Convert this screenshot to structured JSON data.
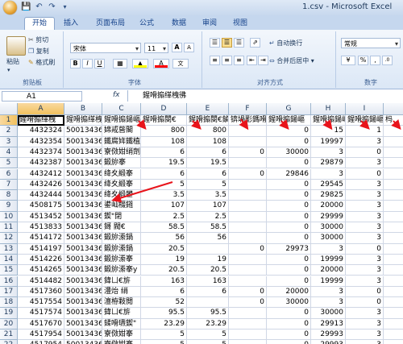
{
  "app": {
    "title": "1.csv - Microsoft Excel",
    "qat_icons": [
      "save-icon",
      "undo-icon",
      "redo-icon"
    ]
  },
  "tabs": [
    "开始",
    "插入",
    "页面布局",
    "公式",
    "数据",
    "审阅",
    "视图"
  ],
  "active_tab": "开始",
  "clipboard": {
    "label": "剪贴板",
    "paste": "粘贴",
    "cut": "剪切",
    "copy": "复制",
    "format_painter": "格式刷"
  },
  "font": {
    "label": "字体",
    "name": "宋体",
    "size": "11",
    "bold": "B",
    "italic": "I",
    "underline": "U",
    "grow": "A",
    "shrink": "A",
    "fill_color": "#ffff00",
    "font_color": "#ff0000"
  },
  "alignment": {
    "label": "对齐方式",
    "wrap": "自动换行",
    "merge": "合并后居中"
  },
  "number": {
    "label": "数字",
    "format": "常规",
    "percent": "%",
    "comma": ","
  },
  "formula_bar": {
    "cell_ref": "A1",
    "fx": "fx",
    "value": "鍟嗗搧缂栧彿"
  },
  "columns": [
    "A",
    "B",
    "C",
    "D",
    "E",
    "F",
    "G",
    "H",
    "I"
  ],
  "selected_column": "A",
  "rows": [
    {
      "n": "1",
      "a": "鍟嗗搧缂栧",
      "b": "鍟嗗搧缂栧",
      "c": "鍟嗗搧鍚嶇",
      "d": "鍟嗗搧閿€",
      "e": "鍟嗗搧閿€鍞",
      "f": "锛堝彲鎷嗗垎",
      "g": "鍟嗗搧鍚嶇",
      "h": "鍟嗗搧鍚嶇",
      "i": "鍟嗗搧鍚嶇",
      "j": "杩"
    },
    {
      "n": "2",
      "a": "4432324",
      "b": "50013436",
      "c": "婂戒蒈閣",
      "d": "800",
      "e": "800",
      "f": "",
      "g": "0",
      "h": "15",
      "i": "1",
      "j": ""
    },
    {
      "n": "3",
      "a": "4432354",
      "b": "50013436",
      "c": "鐵腐姩鐵植",
      "d": "108",
      "e": "108",
      "f": "",
      "g": "0",
      "h": "19997",
      "i": "3",
      "j": ""
    },
    {
      "n": "4",
      "a": "4432374",
      "b": "50013436",
      "c": "寮傚姏绡劑",
      "d": "6",
      "e": "6",
      "f": "0",
      "g": "30000",
      "h": "3",
      "i": "0",
      "j": ""
    },
    {
      "n": "5",
      "a": "4432387",
      "b": "50013436",
      "c": "鍛旀搴",
      "d": "19.5",
      "e": "19.5",
      "f": "",
      "g": "0",
      "h": "29879",
      "i": "3",
      "j": ""
    },
    {
      "n": "6",
      "a": "4432412",
      "b": "50013436",
      "c": "绛夊緞搴",
      "d": "6",
      "e": "6",
      "f": "0",
      "g": "29846",
      "h": "3",
      "i": "0",
      "j": ""
    },
    {
      "n": "7",
      "a": "4432426",
      "b": "50013436",
      "c": "绛夊緞搴",
      "d": "5",
      "e": "5",
      "f": "",
      "g": "0",
      "h": "29545",
      "i": "3",
      "j": ""
    },
    {
      "n": "8",
      "a": "4432444",
      "b": "50013436",
      "c": "绛夊緞鐢",
      "d": "3.5",
      "e": "3.5",
      "f": "",
      "g": "0",
      "h": "29825",
      "i": "3",
      "j": ""
    },
    {
      "n": "9",
      "a": "4508175",
      "b": "50013436",
      "c": "鍙屾棳鎺",
      "d": "107",
      "e": "107",
      "f": "",
      "g": "0",
      "h": "20000",
      "i": "3",
      "j": ""
    },
    {
      "n": "10",
      "a": "4513452",
      "b": "50013436",
      "c": "鍥\"閉",
      "d": "2.5",
      "e": "2.5",
      "f": "",
      "g": "0",
      "h": "29999",
      "i": "3",
      "j": ""
    },
    {
      "n": "11",
      "a": "4513833",
      "b": "50013436",
      "c": "鎶  閥€",
      "d": "58.5",
      "e": "58.5",
      "f": "",
      "g": "0",
      "h": "30000",
      "i": "3",
      "j": ""
    },
    {
      "n": "12",
      "a": "4514172",
      "b": "50013436",
      "c": "鍛旀潫鍋",
      "d": "56",
      "e": "56",
      "f": "",
      "g": "0",
      "h": "30000",
      "i": "3",
      "j": ""
    },
    {
      "n": "13",
      "a": "4514197",
      "b": "50013436",
      "c": "鍛旀潫鍋",
      "d": "20.5",
      "e": "",
      "f": "0",
      "g": "29973",
      "h": "3",
      "i": "0",
      "j": ""
    },
    {
      "n": "14",
      "a": "4514226",
      "b": "50013436",
      "c": "鍛旀潫搴",
      "d": "19",
      "e": "19",
      "f": "",
      "g": "0",
      "h": "19999",
      "i": "3",
      "j": ""
    },
    {
      "n": "15",
      "a": "4514265",
      "b": "50013436",
      "c": "鍛旀潫搴y",
      "d": "20.5",
      "e": "20.5",
      "f": "",
      "g": "0",
      "h": "20000",
      "i": "3",
      "j": ""
    },
    {
      "n": "16",
      "a": "4514482",
      "b": "50013436",
      "c": "鍏ㄩ€旂",
      "d": "163",
      "e": "163",
      "f": "",
      "g": "0",
      "h": "19999",
      "i": "3",
      "j": ""
    },
    {
      "n": "17",
      "a": "4517360",
      "b": "50013436",
      "c": "澧炲 绡",
      "d": "6",
      "e": "6",
      "f": "0",
      "g": "20000",
      "h": "3",
      "i": "0",
      "j": ""
    },
    {
      "n": "18",
      "a": "4517554",
      "b": "50013436",
      "c": "澶栫敤閲",
      "d": "52",
      "e": "",
      "f": "0",
      "g": "30000",
      "h": "3",
      "i": "0",
      "j": ""
    },
    {
      "n": "19",
      "a": "4517574",
      "b": "50013436",
      "c": "鍏ㄩ€旂",
      "d": "95.5",
      "e": "95.5",
      "f": "",
      "g": "0",
      "h": "30000",
      "i": "3",
      "j": ""
    },
    {
      "n": "20",
      "a": "4517670",
      "b": "50013436",
      "c": "鍒嗗瓙鍥\"",
      "d": "23.29",
      "e": "23.29",
      "f": "",
      "g": "0",
      "h": "29913",
      "i": "3",
      "j": ""
    },
    {
      "n": "21",
      "a": "4517954",
      "b": "50013436",
      "c": "寮傚姏搴",
      "d": "5",
      "e": "5",
      "f": "",
      "g": "0",
      "h": "29993",
      "i": "3",
      "j": ""
    },
    {
      "n": "22",
      "a": "4517954",
      "b": "50013436",
      "c": "寮傚姏搴",
      "d": "5",
      "e": "5",
      "f": "",
      "g": "0",
      "h": "29993",
      "i": "3",
      "j": ""
    }
  ],
  "annotation_color": "#e8141b"
}
